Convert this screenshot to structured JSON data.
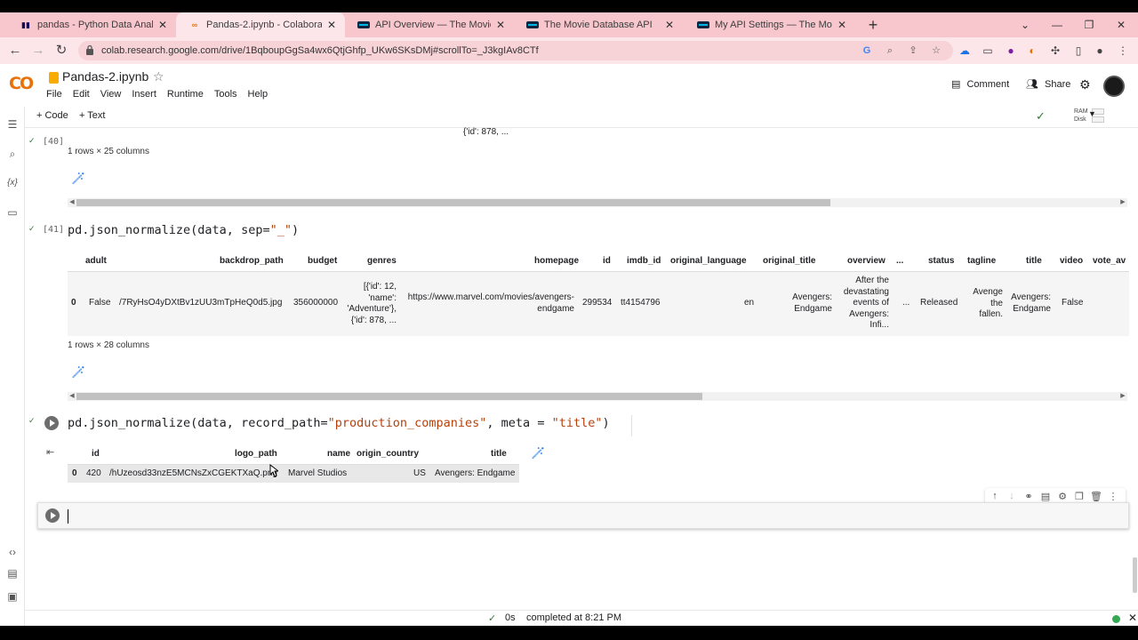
{
  "browser": {
    "tabs": [
      {
        "title": "pandas - Python Data Analysis Li",
        "favicon": "pandas-icon"
      },
      {
        "title": "Pandas-2.ipynb - Colaboratory",
        "favicon": "colab-icon",
        "active": true
      },
      {
        "title": "API Overview — The Movie Datab",
        "favicon": "tmdb-icon"
      },
      {
        "title": "The Movie Database API",
        "favicon": "tmdb-icon"
      },
      {
        "title": "My API Settings — The Movie Da",
        "favicon": "tmdb-icon"
      }
    ],
    "url": "colab.research.google.com/drive/1BqboupGgSa4wx6QtjGhfp_UKw6SKsDMj#scrollTo=_J3kgIAv8CTf"
  },
  "colab": {
    "logo": "CO",
    "doc_title": "Pandas-2.ipynb",
    "menu": [
      "File",
      "Edit",
      "View",
      "Insert",
      "Runtime",
      "Tools",
      "Help"
    ],
    "comment": "Comment",
    "share": "Share",
    "add_code": "+ Code",
    "add_text": "+ Text",
    "ram": "RAM",
    "disk": "Disk"
  },
  "cell40": {
    "exec": "[40]",
    "prev_overflow": "{'id': 878, ...",
    "shape": "1 rows × 25 columns"
  },
  "cell41": {
    "exec": "[41]",
    "code_fn": "pd.json_normalize(data, sep=",
    "code_str": "\"_\"",
    "code_close": ")",
    "columns": [
      "adult",
      "backdrop_path",
      "budget",
      "genres",
      "homepage",
      "id",
      "imdb_id",
      "original_language",
      "original_title",
      "overview",
      "...",
      "status",
      "tagline",
      "title",
      "video",
      "vote_av"
    ],
    "row": {
      "index": "0",
      "adult": "False",
      "backdrop_path": "/7RyHsO4yDXtBv1zUU3mTpHeQ0d5.jpg",
      "budget": "356000000",
      "genres": "[{'id': 12, 'name': 'Adventure'}, {'id': 878, ...",
      "homepage": "https://www.marvel.com/movies/avengers-endgame",
      "id": "299534",
      "imdb_id": "tt4154796",
      "original_language": "en",
      "original_title": "Avengers: Endgame",
      "overview": "After the devastating events of Avengers: Infi...",
      "ellipsis": "...",
      "status": "Released",
      "tagline": "Avenge the fallen.",
      "title": "Avengers: Endgame",
      "video": "False"
    },
    "shape": "1 rows × 28 columns"
  },
  "cell42": {
    "code_a": "pd.json_normalize(data, record_path=",
    "code_str1": "\"production_companies\"",
    "code_b": ", meta = ",
    "code_str2": "\"title\"",
    "code_close": ")",
    "columns": [
      "id",
      "logo_path",
      "name",
      "origin_country",
      "title"
    ],
    "row": {
      "index": "0",
      "id": "420",
      "logo_path": "/hUzeosd33nzE5MCNsZxCGEKTXaQ.png",
      "name": "Marvel Studios",
      "origin_country": "US",
      "title": "Avengers: Endgame"
    }
  },
  "status": {
    "elapsed": "0s",
    "message": "completed at 8:21 PM"
  },
  "colors": {
    "tabbar": "#f7c7cd",
    "accent": "#f9ab00",
    "string": "#b5410c"
  }
}
